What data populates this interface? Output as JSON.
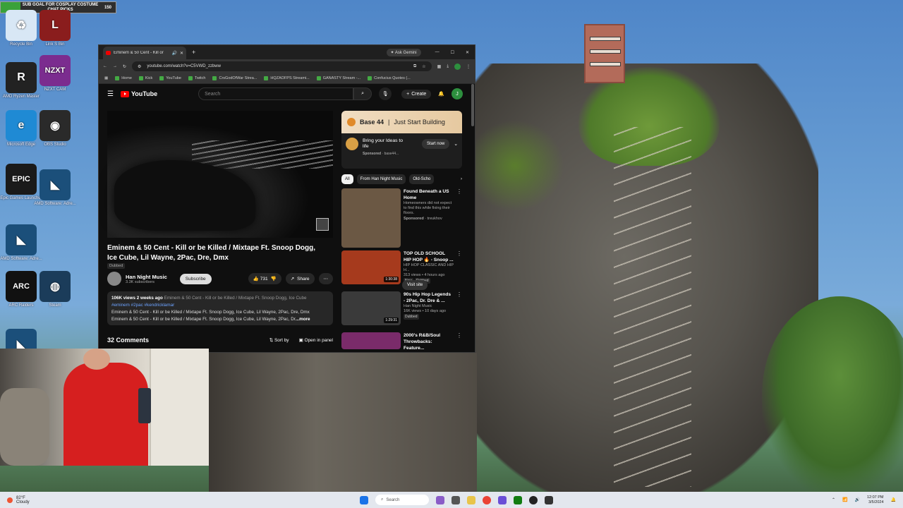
{
  "goal": {
    "text": "SUB GOAL FOR COSPLAY COSTUME CHAT PICKS",
    "count": "150"
  },
  "desktop_icons": [
    {
      "label": "Recycle Bin",
      "color": "#d8e7f5",
      "glyph": "♻"
    },
    {
      "label": "Link S Bin",
      "color": "#8a1d1d",
      "glyph": "L"
    },
    {
      "label": "AMD Ryzen Master",
      "color": "#222222",
      "glyph": "R"
    },
    {
      "label": "NZXT CAM",
      "color": "#7b2c8f",
      "glyph": "NZXT"
    },
    {
      "label": "Microsoft Edge",
      "color": "#1f8ad4",
      "glyph": "e"
    },
    {
      "label": "OBS Studio",
      "color": "#2a2a2a",
      "glyph": "◉"
    },
    {
      "label": "Epic Games Launcher",
      "color": "#1a1a1a",
      "glyph": "EPIC"
    },
    {
      "label": "AMD Software: Adre...",
      "color": "#1b4f7a",
      "glyph": "◣"
    },
    {
      "label": "AMD Software: Adre...",
      "color": "#1b4f7a",
      "glyph": "◣"
    },
    {
      "label": "ARC Raiders",
      "color": "#111111",
      "glyph": "ARC"
    },
    {
      "label": "Steam",
      "color": "#1b3c5a",
      "glyph": "◍"
    },
    {
      "label": "",
      "color": "#1b4f7a",
      "glyph": "◣"
    }
  ],
  "browser": {
    "tab_title": "Eminem & 50 Cent - Kill or",
    "ask_gemini": "Ask Gemini",
    "url": "youtube.com/watch?v=C5VWD_zzbww",
    "bookmarks": [
      "Home",
      "Kick",
      "YouTube",
      "Twitch",
      "CrsGodOfWar Strea...",
      "HQZAOFPS Streami...",
      "GANASTY Stream -...",
      "Confucius Quotes (..."
    ]
  },
  "youtube": {
    "logo": "YouTube",
    "search_placeholder": "Search",
    "create": "Create",
    "avatar": "J",
    "video_title": "Eminem & 50 Cent - Kill or be Killed / Mixtape Ft. Snoop Dogg, Ice Cube, Lil Wayne, 2Pac, Dre, Dmx",
    "dubbed": "Dubbed",
    "channel_name": "Han Night Music",
    "subscribers": "3.3K subscribers",
    "subscribe": "Subscribe",
    "likes": "731",
    "share": "Share",
    "desc_views": "106K views",
    "desc_date": "2 weeks ago",
    "desc_title_dim": "Eminem & 50 Cent - Kill or be Killed / Mixtape Ft. Snoop Dogg, Ice Cube",
    "desc_tags": "#eminem #2pac #kendricklamar",
    "desc_line2": "Eminem & 50 Cent - Kill or be Killed / Mixtape Ft. Snoop Dogg, Ice Cube, Lil Wayne, 2Pac, Dre, Dmx",
    "desc_line3": "Eminem & 50 Cent - Kill or be Killed / Mixtape Ft. Snoop Dogg, Ice Cube, Lil Wayne, 2Pac, Dr",
    "desc_more": "...more",
    "comments": "32 Comments",
    "sort_by": "Sort by",
    "open_panel": "Open in panel",
    "ad": {
      "brand": "Base 44",
      "tagline": "Just Start Building",
      "headline": "Bring your Ideas to life",
      "sponsored": "Sponsored",
      "domain": "base44...",
      "cta": "Start now"
    },
    "chips": [
      "All",
      "From Han Night Music",
      "Old-Scho"
    ],
    "recs": [
      {
        "title": "Found Beneath a US Home",
        "sub": "Homeowners did not expect to find this while fixing their floors.",
        "meta": "Sponsored",
        "meta2": "treukhov",
        "thumb": "#6b5844",
        "duration": "",
        "cta": "Visit site"
      },
      {
        "title": "TOP OLD SCHOOL HIP HOP 🔥 - Snoop ...",
        "sub": "HIP HOP CLASSIC AND HIP H...",
        "meta": "313 views • 4 hours ago",
        "badge1": "New",
        "badge2": "Dubbed",
        "thumb": "#a63a1d",
        "duration": "1:30:38"
      },
      {
        "title": "90s Hip Hop Legends - 2Pac, Dr. Dre & ...",
        "sub": "Han Night Music",
        "meta": "16K views • 10 days ago",
        "badge2": "Dubbed",
        "thumb": "#3a3a3a",
        "duration": "1:29:31"
      },
      {
        "title": "2000's R&B/Soul Throwbacks: Feature...",
        "sub": "",
        "meta": "",
        "thumb": "#7a2b6a",
        "duration": ""
      }
    ]
  },
  "taskbar": {
    "temp": "82°F",
    "condition": "Cloudy",
    "search": "Search",
    "time": "12:07 PM",
    "date": "3/5/2024"
  }
}
